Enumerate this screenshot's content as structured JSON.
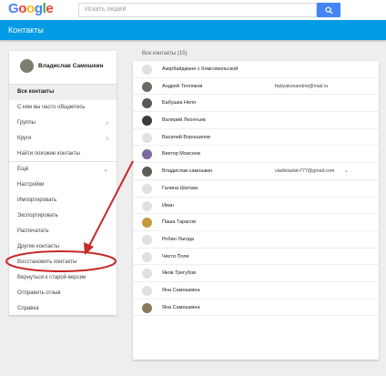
{
  "logo": {
    "letters": [
      "G",
      "o",
      "o",
      "g",
      "l",
      "e"
    ],
    "colors": [
      "#4285f4",
      "#ea4335",
      "#fbbc05",
      "#4285f4",
      "#34a853",
      "#ea4335"
    ]
  },
  "search": {
    "placeholder": "Искать людей"
  },
  "appbar": {
    "title": "Контакты",
    "color": "#039be5"
  },
  "profile": {
    "name": "Владислав Самошкин"
  },
  "sidebar": {
    "items": [
      {
        "label": "Все контакты"
      },
      {
        "label": "С кем вы часто общаетесь"
      },
      {
        "label": "Группы",
        "chevron": "›"
      },
      {
        "label": "Круги",
        "chevron": "›"
      },
      {
        "label": "Найти похожие контакты"
      },
      {
        "label": "Ещё",
        "chevron": "⌄"
      },
      {
        "label": "Настройки"
      },
      {
        "label": "Импортировать"
      },
      {
        "label": "Экспортировать"
      },
      {
        "label": "Распечатать"
      },
      {
        "label": "Другие контакты"
      },
      {
        "label": "Восстановить контакты"
      },
      {
        "label": "Вернуться к старой версии"
      },
      {
        "label": "Отправить отзыв"
      },
      {
        "label": "Справка"
      }
    ]
  },
  "main": {
    "section_title": "Все контакты (15)",
    "contacts": [
      {
        "name": "Азербайджане с Комсомольской",
        "email": ""
      },
      {
        "name": "Андрей Тепляков",
        "email": "feplyakovandrei@mail.ru"
      },
      {
        "name": "Бабушка Неля",
        "email": ""
      },
      {
        "name": "Валерий Леонтьев",
        "email": ""
      },
      {
        "name": "Василий Ворошилов",
        "email": ""
      },
      {
        "name": "Виктор Моисеев",
        "email": ""
      },
      {
        "name": "Владислав самошкин",
        "email": "vladislavkin777@gmail.com",
        "caret": "⌄"
      },
      {
        "name": "Галина Шатова",
        "email": ""
      },
      {
        "name": "Иван",
        "email": ""
      },
      {
        "name": "Паша Тарасов",
        "email": ""
      },
      {
        "name": "Робин Лагода",
        "email": ""
      },
      {
        "name": "Чисто Поле",
        "email": ""
      },
      {
        "name": "Яков Трегубов",
        "email": ""
      },
      {
        "name": "Яна Самошкина",
        "email": ""
      },
      {
        "name": "Яна Самошкина",
        "email": ""
      }
    ]
  },
  "annotation": {
    "color": "#c62828"
  }
}
